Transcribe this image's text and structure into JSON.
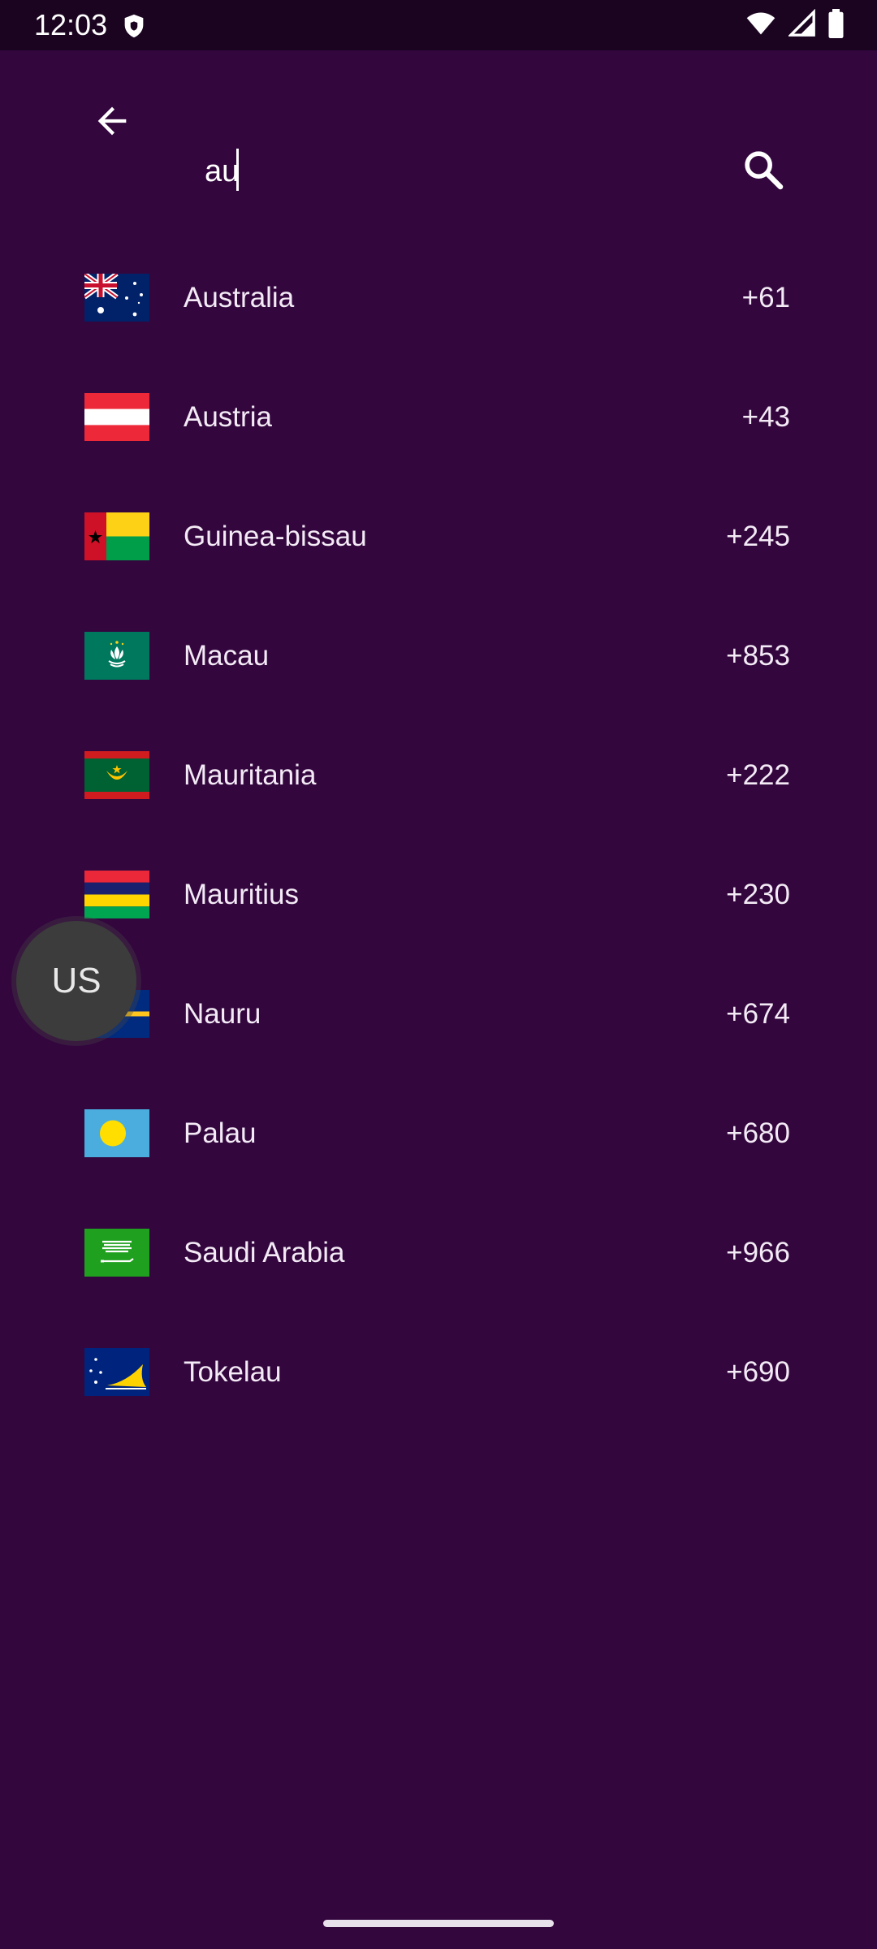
{
  "status_bar": {
    "time": "12:03",
    "icons": [
      "shield-icon",
      "wifi-icon",
      "signal-icon",
      "battery-icon"
    ]
  },
  "toolbar": {
    "back_icon": "arrow-left-icon",
    "search_value": "au",
    "search_icon": "search-icon"
  },
  "countries": [
    {
      "name": "Australia",
      "code": "+61",
      "flag": "australia-flag-icon"
    },
    {
      "name": "Austria",
      "code": "+43",
      "flag": "austria-flag-icon"
    },
    {
      "name": "Guinea-bissau",
      "code": "+245",
      "flag": "guinea-bissau-flag-icon"
    },
    {
      "name": "Macau",
      "code": "+853",
      "flag": "macau-flag-icon"
    },
    {
      "name": "Mauritania",
      "code": "+222",
      "flag": "mauritania-flag-icon"
    },
    {
      "name": "Mauritius",
      "code": "+230",
      "flag": "mauritius-flag-icon"
    },
    {
      "name": "Nauru",
      "code": "+674",
      "flag": "nauru-flag-icon"
    },
    {
      "name": "Palau",
      "code": "+680",
      "flag": "palau-flag-icon"
    },
    {
      "name": "Saudi Arabia",
      "code": "+966",
      "flag": "saudi-arabia-flag-icon"
    },
    {
      "name": "Tokelau",
      "code": "+690",
      "flag": "tokelau-flag-icon"
    }
  ],
  "fast_scroll": {
    "label": "US"
  },
  "colors": {
    "background": "#33063e",
    "status_bar": "#1b0420",
    "text": "#f3eaf5",
    "fab": "#3c3c3c"
  }
}
